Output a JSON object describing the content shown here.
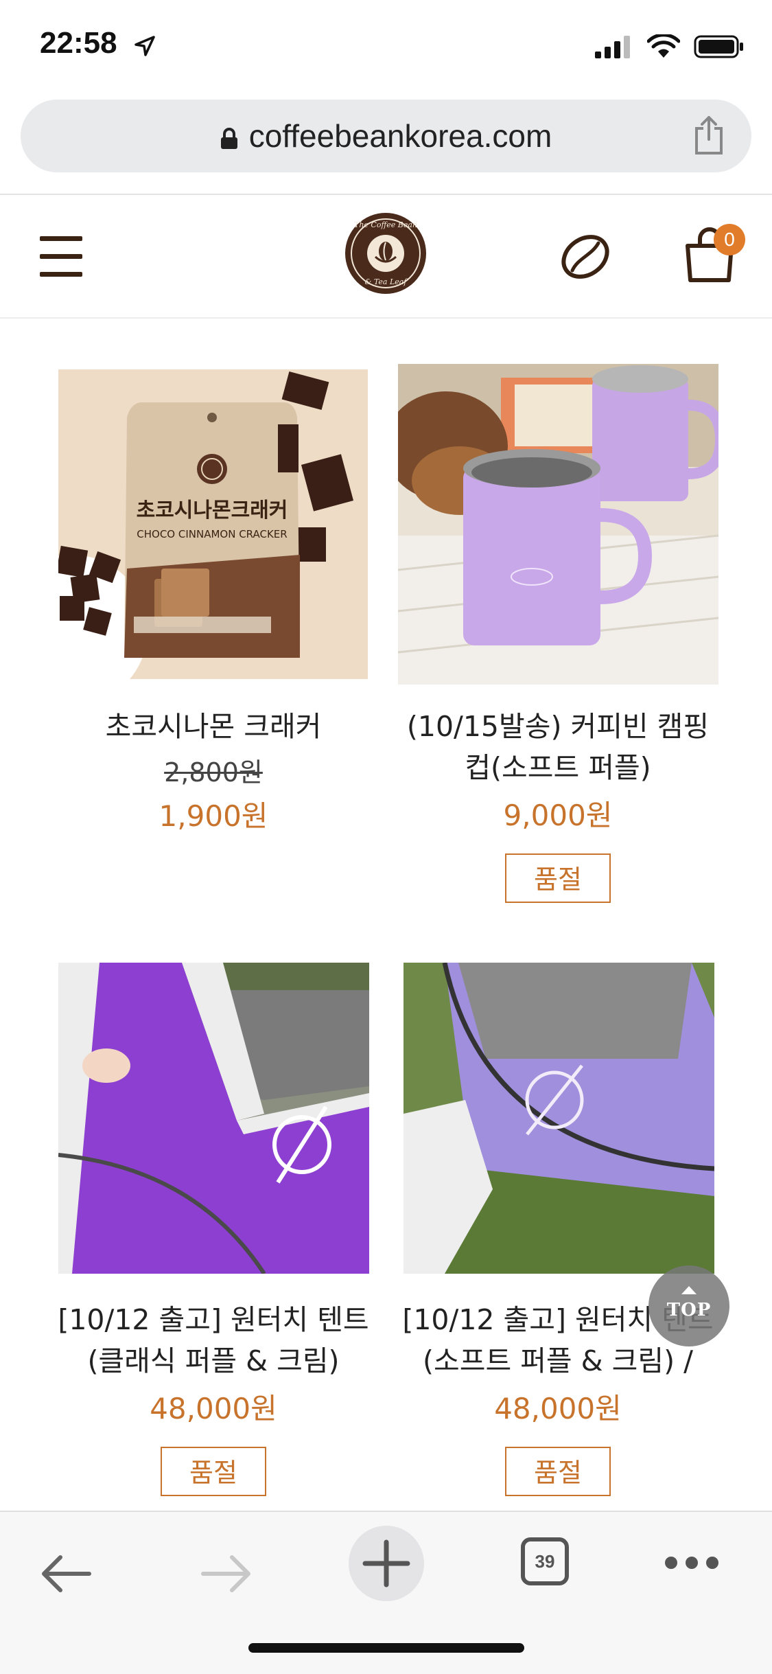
{
  "status_bar": {
    "time": "22:58",
    "icons": [
      "location-arrow-icon",
      "signal-icon",
      "wifi-icon",
      "battery-icon"
    ]
  },
  "browser": {
    "url": "coffeebeankorea.com",
    "icons": [
      "lock-icon",
      "share-icon"
    ]
  },
  "site_header": {
    "logo_alt": "The Coffee Bean & Tea Leaf",
    "cart_count": "0",
    "icons": [
      "hamburger-menu-icon",
      "coffee-bean-icon",
      "shopping-bag-icon"
    ]
  },
  "products": [
    {
      "name_line1": "초코시나몬 크래커",
      "name_line2": "",
      "old_price": "2,800원",
      "price": "1,900원",
      "soldout": "",
      "image": "choco-cinnamon-cracker-pack",
      "package_text": "초코시나몬크래커",
      "package_subtext": "CHOCO CINNAMON CRACKER"
    },
    {
      "name_line1": "(10/15발송) 커피빈 캠핑",
      "name_line2": "컵(소프트 퍼플)",
      "old_price": "",
      "price": "9,000원",
      "soldout": "품절",
      "image": "purple-camping-mugs"
    },
    {
      "name_line1": "[10/12 출고] 원터치 텐트",
      "name_line2": "(클래식 퍼플 & 크림)",
      "old_price": "",
      "price": "48,000원",
      "soldout": "품절",
      "image": "classic-purple-tent"
    },
    {
      "name_line1": "[10/12 출고] 원터치 텐트",
      "name_line2": "(소프트 퍼플 & 크림) /",
      "old_price": "",
      "price": "48,000원",
      "soldout": "품절",
      "image": "soft-purple-tent"
    }
  ],
  "top_button": "TOP",
  "toolbar": {
    "tab_count": "39",
    "icons": [
      "back-arrow-icon",
      "forward-arrow-icon",
      "new-tab-plus-icon",
      "tabs-icon",
      "more-icon"
    ]
  },
  "colors": {
    "price_orange": "#c8732c",
    "brand_brown": "#3b2314",
    "badge_orange": "#e07c2a",
    "tent_purple": "#8a3fd1",
    "mug_lilac": "#c9a6e8"
  }
}
